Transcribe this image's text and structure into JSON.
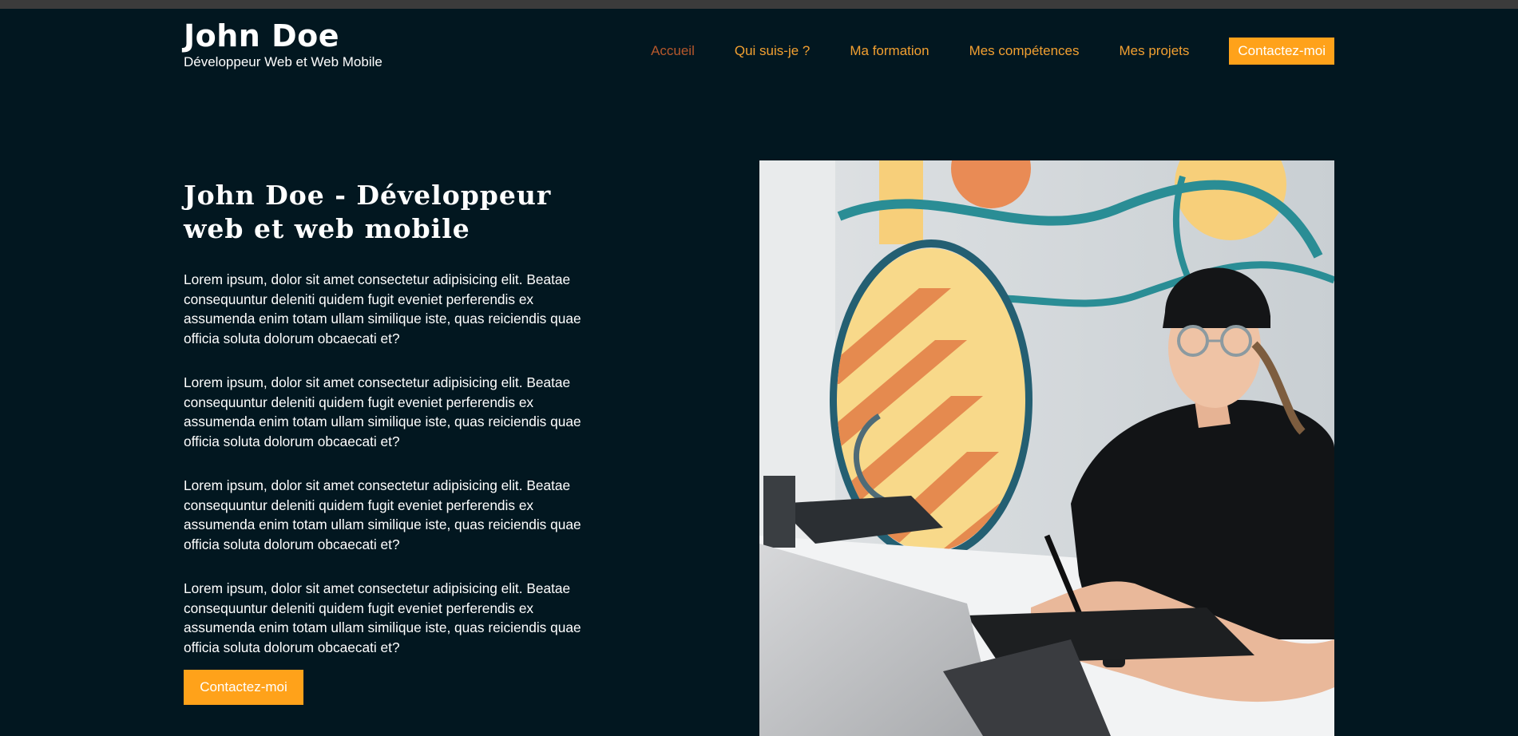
{
  "header": {
    "brand_name": "John Doe",
    "brand_tagline": "Développeur Web et Web Mobile"
  },
  "nav": {
    "items": [
      {
        "label": "Accueil",
        "active": true
      },
      {
        "label": "Qui suis-je ?"
      },
      {
        "label": "Ma formation"
      },
      {
        "label": "Mes compétences"
      },
      {
        "label": "Mes projets"
      }
    ],
    "cta_label": "Contactez-moi"
  },
  "hero": {
    "title": "John Doe - Développeur web et web mobile",
    "paragraphs": [
      "Lorem ipsum, dolor sit amet consectetur adipisicing elit. Beatae consequuntur deleniti quidem fugit eveniet perferendis ex assumenda enim totam ullam similique iste, quas reiciendis quae officia soluta dolorum obcaecati et?",
      "Lorem ipsum, dolor sit amet consectetur adipisicing elit. Beatae consequuntur deleniti quidem fugit eveniet perferendis ex assumenda enim totam ullam similique iste, quas reiciendis quae officia soluta dolorum obcaecati et?",
      "Lorem ipsum, dolor sit amet consectetur adipisicing elit. Beatae consequuntur deleniti quidem fugit eveniet perferendis ex assumenda enim totam ullam similique iste, quas reiciendis quae officia soluta dolorum obcaecati et?",
      "Lorem ipsum, dolor sit amet consectetur adipisicing elit. Beatae consequuntur deleniti quidem fugit eveniet perferendis ex assumenda enim totam ullam similique iste, quas reiciendis quae officia soluta dolorum obcaecati et?"
    ],
    "cta_label": "Contactez-moi"
  },
  "colors": {
    "background": "#021720",
    "accent": "#ffa21a",
    "nav_link": "#f2a031",
    "nav_active": "#b6582c"
  }
}
